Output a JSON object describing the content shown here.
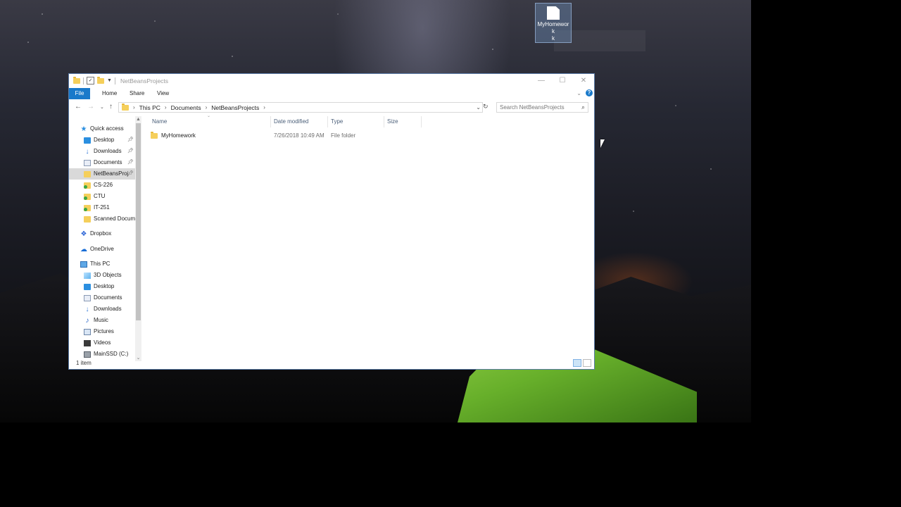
{
  "desktop": {
    "icon_label": "MyHomework",
    "icon_label_wrap": "k"
  },
  "window": {
    "title": "NetBeansProjects",
    "controls": {
      "minimize": "—",
      "maximize": "☐",
      "close": "✕"
    }
  },
  "ribbon": {
    "tabs": [
      "File",
      "Home",
      "Share",
      "View"
    ],
    "help": "?"
  },
  "address": {
    "crumbs": [
      "This PC",
      "Documents",
      "NetBeansProjects"
    ]
  },
  "search": {
    "placeholder": "Search NetBeansProjects"
  },
  "nav": {
    "quick_access": "Quick access",
    "quick_items": [
      "Desktop",
      "Downloads",
      "Documents",
      "NetBeansProj",
      "CS-226",
      "CTU",
      "IT-251",
      "Scanned Docum"
    ],
    "dropbox": "Dropbox",
    "onedrive": "OneDrive",
    "this_pc": "This PC",
    "pc_items": [
      "3D Objects",
      "Desktop",
      "Documents",
      "Downloads",
      "Music",
      "Pictures",
      "Videos",
      "MainSSD (C:)"
    ]
  },
  "columns": {
    "name": "Name",
    "date": "Date modified",
    "type": "Type",
    "size": "Size"
  },
  "files": [
    {
      "name": "MyHomework",
      "date": "7/26/2018 10:49 AM",
      "type": "File folder",
      "size": ""
    }
  ],
  "status": {
    "count": "1 item"
  }
}
